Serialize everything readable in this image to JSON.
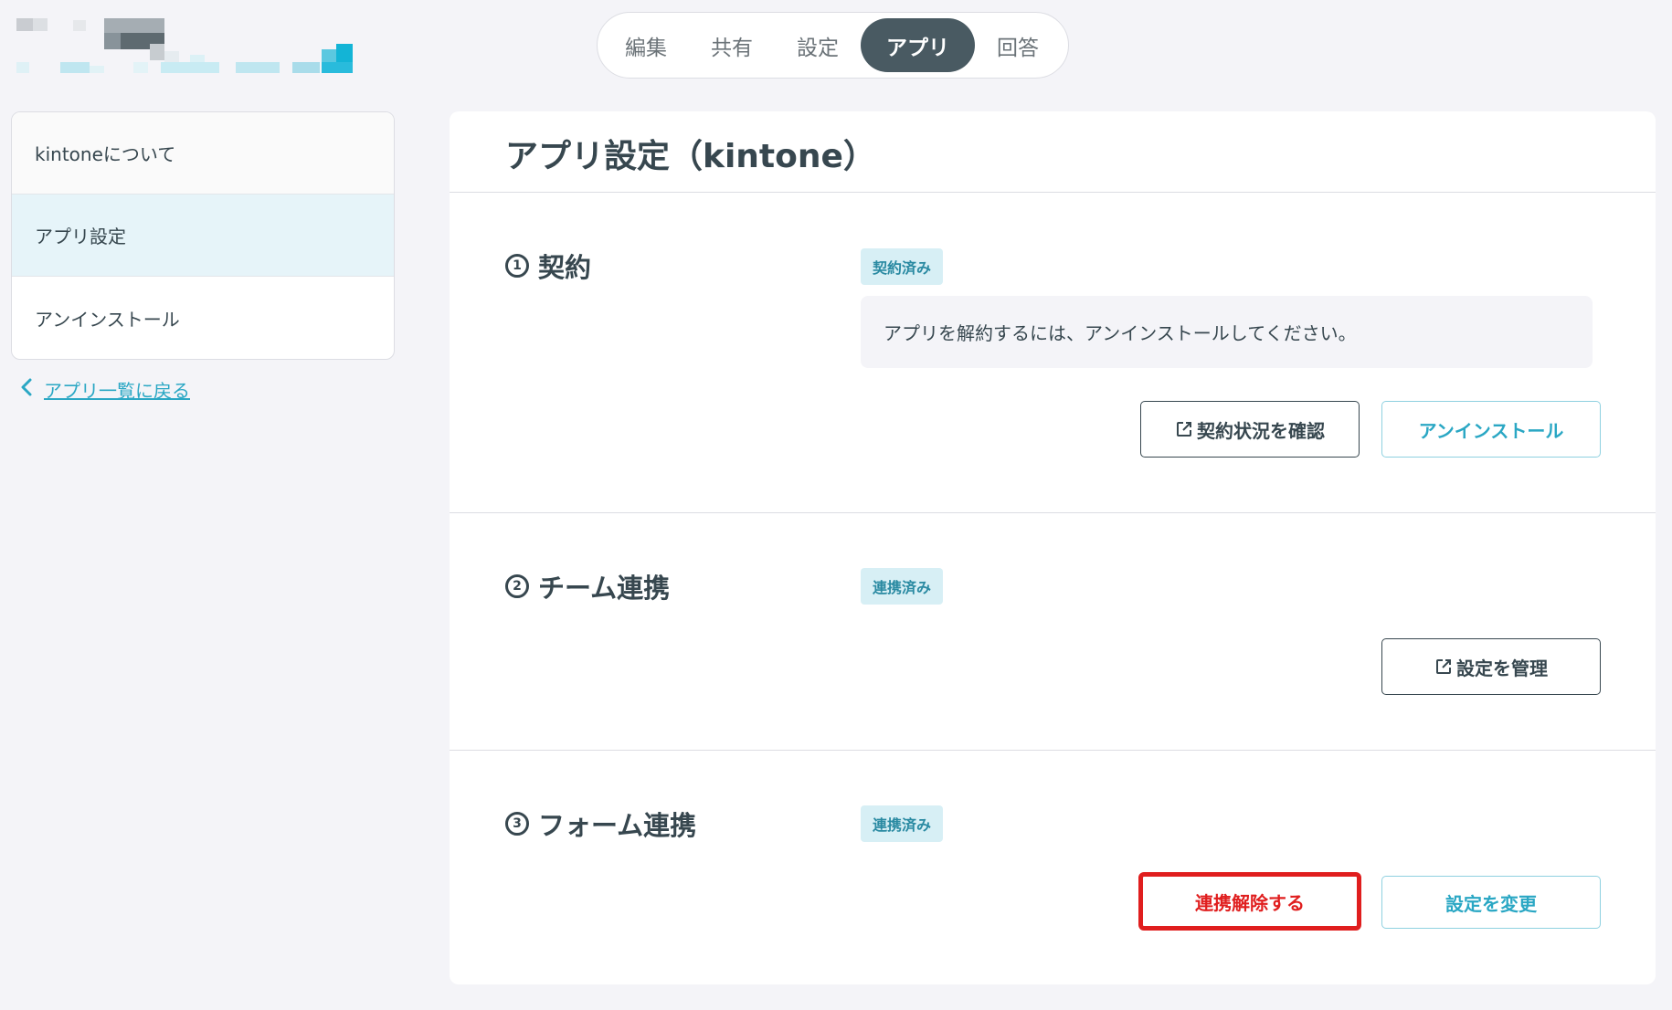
{
  "tabs": [
    {
      "label": "編集"
    },
    {
      "label": "共有"
    },
    {
      "label": "設定"
    },
    {
      "label": "アプリ"
    },
    {
      "label": "回答"
    }
  ],
  "active_tab": "アプリ",
  "sidebar": {
    "items": [
      {
        "label": "kintoneについて"
      },
      {
        "label": "アプリ設定"
      },
      {
        "label": "アンインストール"
      }
    ],
    "active_item": "アプリ設定"
  },
  "back_link": {
    "label": "アプリ一覧に戻る",
    "icon": "chevron-left-icon"
  },
  "main": {
    "title": "アプリ設定（kintone）",
    "sections": [
      {
        "number": "1",
        "title": "契約",
        "badge": "契約済み",
        "note": "アプリを解約するには、アンインストールしてください。",
        "buttons": [
          {
            "label": "契約状況を確認",
            "icon": "external-link-icon"
          },
          {
            "label": "アンインストール"
          }
        ]
      },
      {
        "number": "2",
        "title": "チーム連携",
        "badge": "連携済み",
        "buttons": [
          {
            "label": "設定を管理",
            "icon": "external-link-icon"
          }
        ]
      },
      {
        "number": "3",
        "title": "フォーム連携",
        "badge": "連携済み",
        "buttons": [
          {
            "label": "連携解除する"
          },
          {
            "label": "設定を変更"
          }
        ]
      }
    ]
  },
  "colors": {
    "background": "#f4f4f8",
    "active_tab": "#495a62",
    "accent": "#2aa7c4",
    "badge_bg": "#d7eff5",
    "sidebar_active": "#e6f4f9",
    "danger": "#e01e1e"
  }
}
